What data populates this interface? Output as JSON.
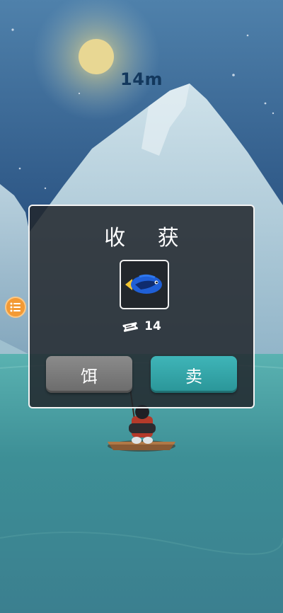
{
  "hud": {
    "depth": "14m"
  },
  "dialog": {
    "title": "收 获",
    "catch_icon": "blue-tang-fish-icon",
    "reward": {
      "icon": "ticket-icon",
      "amount": "14"
    },
    "buttons": {
      "bait": "饵",
      "sell": "卖"
    }
  },
  "side_menu": {
    "icon": "list-menu-icon"
  },
  "colors": {
    "sky": "#3a6796",
    "water": "#3f8f92",
    "sell_button": "#2a9598",
    "bait_button": "#757575",
    "menu_button": "#f39a35"
  }
}
